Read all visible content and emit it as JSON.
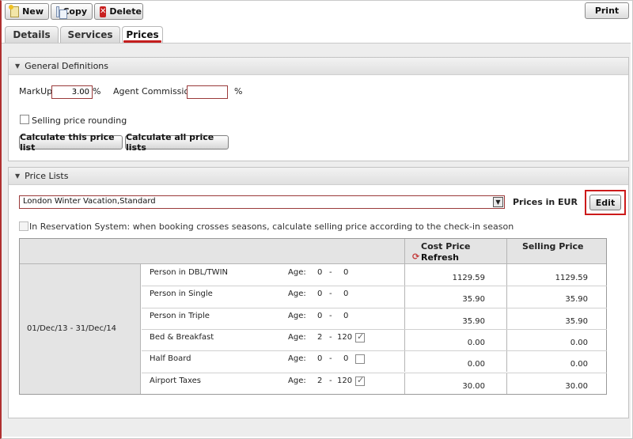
{
  "toolbar": {
    "new_label": "New",
    "copy_label": "Copy",
    "delete_label": "Delete",
    "print_label": "Print"
  },
  "tabs": [
    {
      "label": "Details",
      "active": false
    },
    {
      "label": "Services",
      "active": false
    },
    {
      "label": "Prices",
      "active": true
    }
  ],
  "general": {
    "title": "General Definitions",
    "markup_label": "MarkUp:",
    "markup_value": "3.00",
    "markup_unit": "%",
    "agent_commission_label": "Agent Commission:",
    "agent_commission_value": "",
    "agent_commission_unit": "%",
    "rounding_label": "Selling price rounding",
    "rounding_checked": false,
    "calc_this_label": "Calculate this price list",
    "calc_all_label": "Calculate all price lists"
  },
  "price_lists": {
    "title": "Price Lists",
    "selected": "London Winter Vacation,Standard",
    "currency_label": "Prices in EUR",
    "edit_label": "Edit",
    "reservation_note": "In Reservation System: when booking crosses seasons, calculate selling price according to the check-in season",
    "columns": {
      "cost_price": "Cost Price",
      "refresh": "Refresh",
      "selling_price": "Selling Price"
    },
    "period": "01/Dec/13 - 31/Dec/14",
    "rows": [
      {
        "name": "Person in DBL/TWIN",
        "age_label": "Age:",
        "age_from": "0",
        "sep": "-",
        "age_to": "0",
        "checkbox": false,
        "checked": false,
        "cost": "1129.59",
        "selling": "1129.59"
      },
      {
        "name": "Person in Single",
        "age_label": "Age:",
        "age_from": "0",
        "sep": "-",
        "age_to": "0",
        "checkbox": false,
        "checked": false,
        "cost": "35.90",
        "selling": "35.90"
      },
      {
        "name": "Person in Triple",
        "age_label": "Age:",
        "age_from": "0",
        "sep": "-",
        "age_to": "0",
        "checkbox": false,
        "checked": false,
        "cost": "35.90",
        "selling": "35.90"
      },
      {
        "name": "Bed & Breakfast",
        "age_label": "Age:",
        "age_from": "2",
        "sep": "-",
        "age_to": "120",
        "checkbox": true,
        "checked": true,
        "cost": "0.00",
        "selling": "0.00"
      },
      {
        "name": "Half Board",
        "age_label": "Age:",
        "age_from": "0",
        "sep": "-",
        "age_to": "0",
        "checkbox": true,
        "checked": false,
        "cost": "0.00",
        "selling": "0.00"
      },
      {
        "name": "Airport Taxes",
        "age_label": "Age:",
        "age_from": "2",
        "sep": "-",
        "age_to": "120",
        "checkbox": true,
        "checked": true,
        "cost": "30.00",
        "selling": "30.00"
      }
    ]
  }
}
